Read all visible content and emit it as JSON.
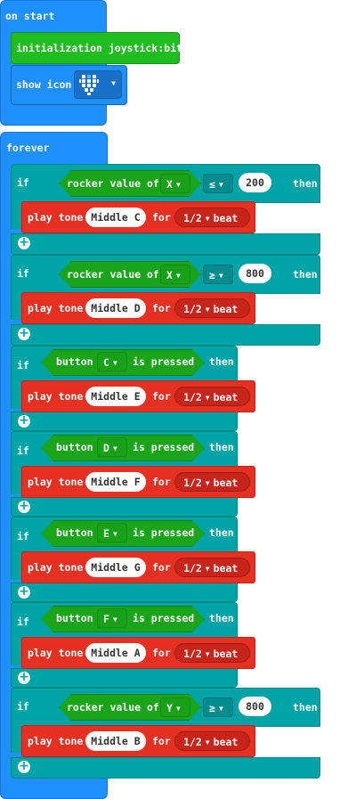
{
  "on_start": {
    "label": "on start",
    "init_label": "initialization joystick:bit",
    "show_icon_label": "show icon",
    "icon_name": "heart-icon"
  },
  "forever": {
    "label": "forever",
    "blocks": [
      {
        "if": "if",
        "cond_type": "rocker",
        "cond_label": "rocker value of",
        "axis": "X",
        "op": "≤",
        "value": "200",
        "then": "then",
        "play": "play tone",
        "note": "Middle C",
        "for": "for",
        "beat": "1/2",
        "beat_unit": "beat"
      },
      {
        "if": "if",
        "cond_type": "rocker",
        "cond_label": "rocker value of",
        "axis": "X",
        "op": "≥",
        "value": "800",
        "then": "then",
        "play": "play tone",
        "note": "Middle D",
        "for": "for",
        "beat": "1/2",
        "beat_unit": "beat"
      },
      {
        "if": "if",
        "cond_type": "button",
        "cond_label": "button",
        "button": "C",
        "pressed": "is pressed",
        "then": "then",
        "play": "play tone",
        "note": "Middle E",
        "for": "for",
        "beat": "1/2",
        "beat_unit": "beat"
      },
      {
        "if": "if",
        "cond_type": "button",
        "cond_label": "button",
        "button": "D",
        "pressed": "is pressed",
        "then": "then",
        "play": "play tone",
        "note": "Middle F",
        "for": "for",
        "beat": "1/2",
        "beat_unit": "beat"
      },
      {
        "if": "if",
        "cond_type": "button",
        "cond_label": "button",
        "button": "E",
        "pressed": "is pressed",
        "then": "then",
        "play": "play tone",
        "note": "Middle G",
        "for": "for",
        "beat": "1/2",
        "beat_unit": "beat"
      },
      {
        "if": "if",
        "cond_type": "button",
        "cond_label": "button",
        "button": "F",
        "pressed": "is pressed",
        "then": "then",
        "play": "play tone",
        "note": "Middle A",
        "for": "for",
        "beat": "1/2",
        "beat_unit": "beat"
      },
      {
        "if": "if",
        "cond_type": "rocker",
        "cond_label": "rocker value of",
        "axis": "Y",
        "op": "≥",
        "value": "800",
        "then": "then",
        "play": "play tone",
        "note": "Middle B",
        "for": "for",
        "beat": "1/2",
        "beat_unit": "beat"
      }
    ]
  },
  "colors": {
    "event": "#1e90ff",
    "logic": "#00a4a6",
    "music": "#e63022",
    "input": "#20bd20"
  }
}
